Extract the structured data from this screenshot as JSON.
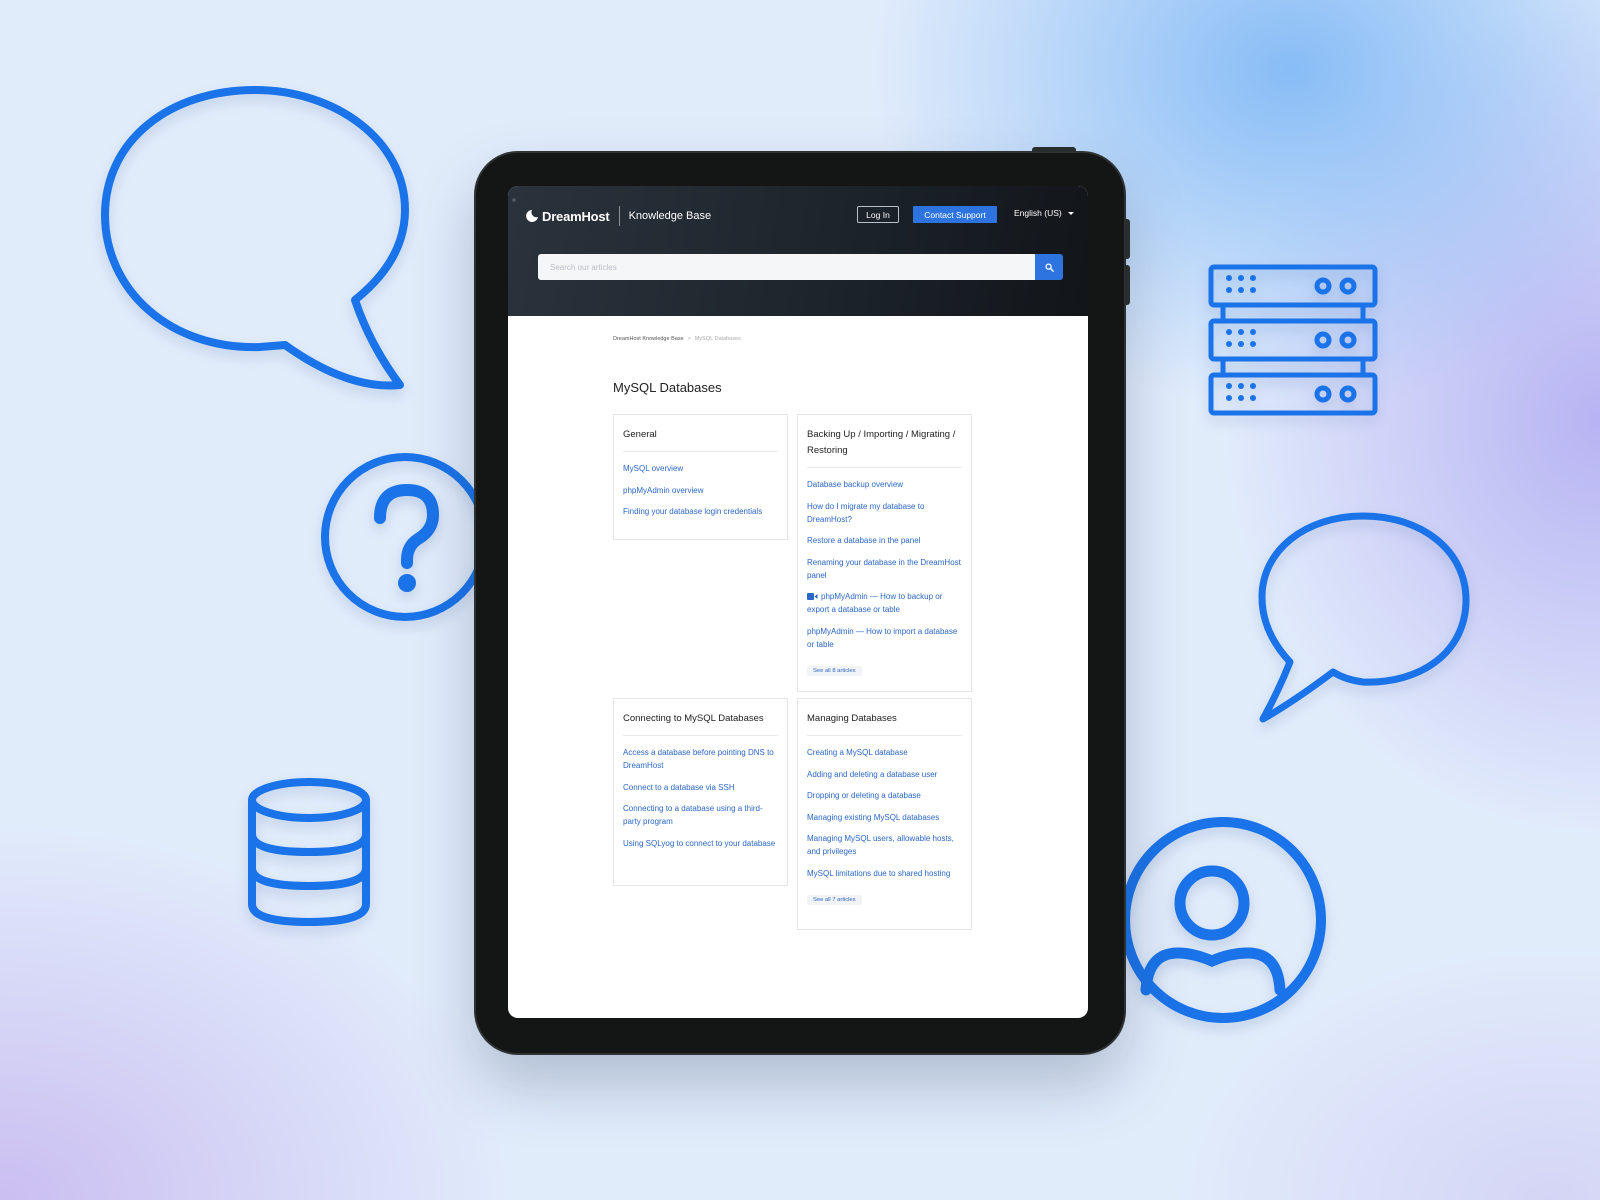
{
  "header": {
    "brand": "DreamHost",
    "section": "Knowledge Base",
    "login_label": "Log In",
    "contact_label": "Contact Support",
    "language": "English (US)"
  },
  "search": {
    "placeholder": "Search our articles",
    "button_icon": "search-icon"
  },
  "breadcrumb": {
    "root": "DreamHost Knowledge Base",
    "separator": ">",
    "current": "MySQL Databases"
  },
  "page": {
    "title": "MySQL Databases"
  },
  "sections": [
    {
      "title": "General",
      "articles": [
        {
          "label": "MySQL overview"
        },
        {
          "label": "phpMyAdmin overview"
        },
        {
          "label": "Finding your database login credentials"
        }
      ]
    },
    {
      "title": "Backing Up / Importing / Migrating / Restoring",
      "articles": [
        {
          "label": "Database backup overview"
        },
        {
          "label": "How do I migrate my database to DreamHost?"
        },
        {
          "label": "Restore a database in the panel"
        },
        {
          "label": "Renaming your database in the DreamHost panel"
        },
        {
          "label": "phpMyAdmin — How to backup or export a database or table",
          "icon": "video-icon"
        },
        {
          "label": "phpMyAdmin — How to import a database or table"
        }
      ],
      "see_all": "See all 8 articles"
    },
    {
      "title": "Connecting to MySQL Databases",
      "articles": [
        {
          "label": "Access a database before pointing DNS to DreamHost"
        },
        {
          "label": "Connect to a database via SSH"
        },
        {
          "label": "Connecting to a database using a third-party program"
        },
        {
          "label": "Using SQLyog to connect to your database"
        }
      ]
    },
    {
      "title": "Managing Databases",
      "articles": [
        {
          "label": "Creating a MySQL database"
        },
        {
          "label": "Adding and deleting a database user"
        },
        {
          "label": "Dropping or deleting a database"
        },
        {
          "label": "Managing existing MySQL databases"
        },
        {
          "label": "Managing MySQL users, allowable hosts, and privileges"
        },
        {
          "label": "MySQL limitations due to shared hosting"
        }
      ],
      "see_all": "See all 7 articles"
    }
  ],
  "decorations": [
    "speech-bubble-icon",
    "question-icon",
    "server-rack-icon",
    "speech-bubble-icon",
    "database-icon",
    "user-icon"
  ],
  "colors": {
    "accent": "#2d74e0",
    "link": "#2b67c6",
    "icon_blue": "#1a73e8",
    "header_dark": "#1d242c"
  }
}
